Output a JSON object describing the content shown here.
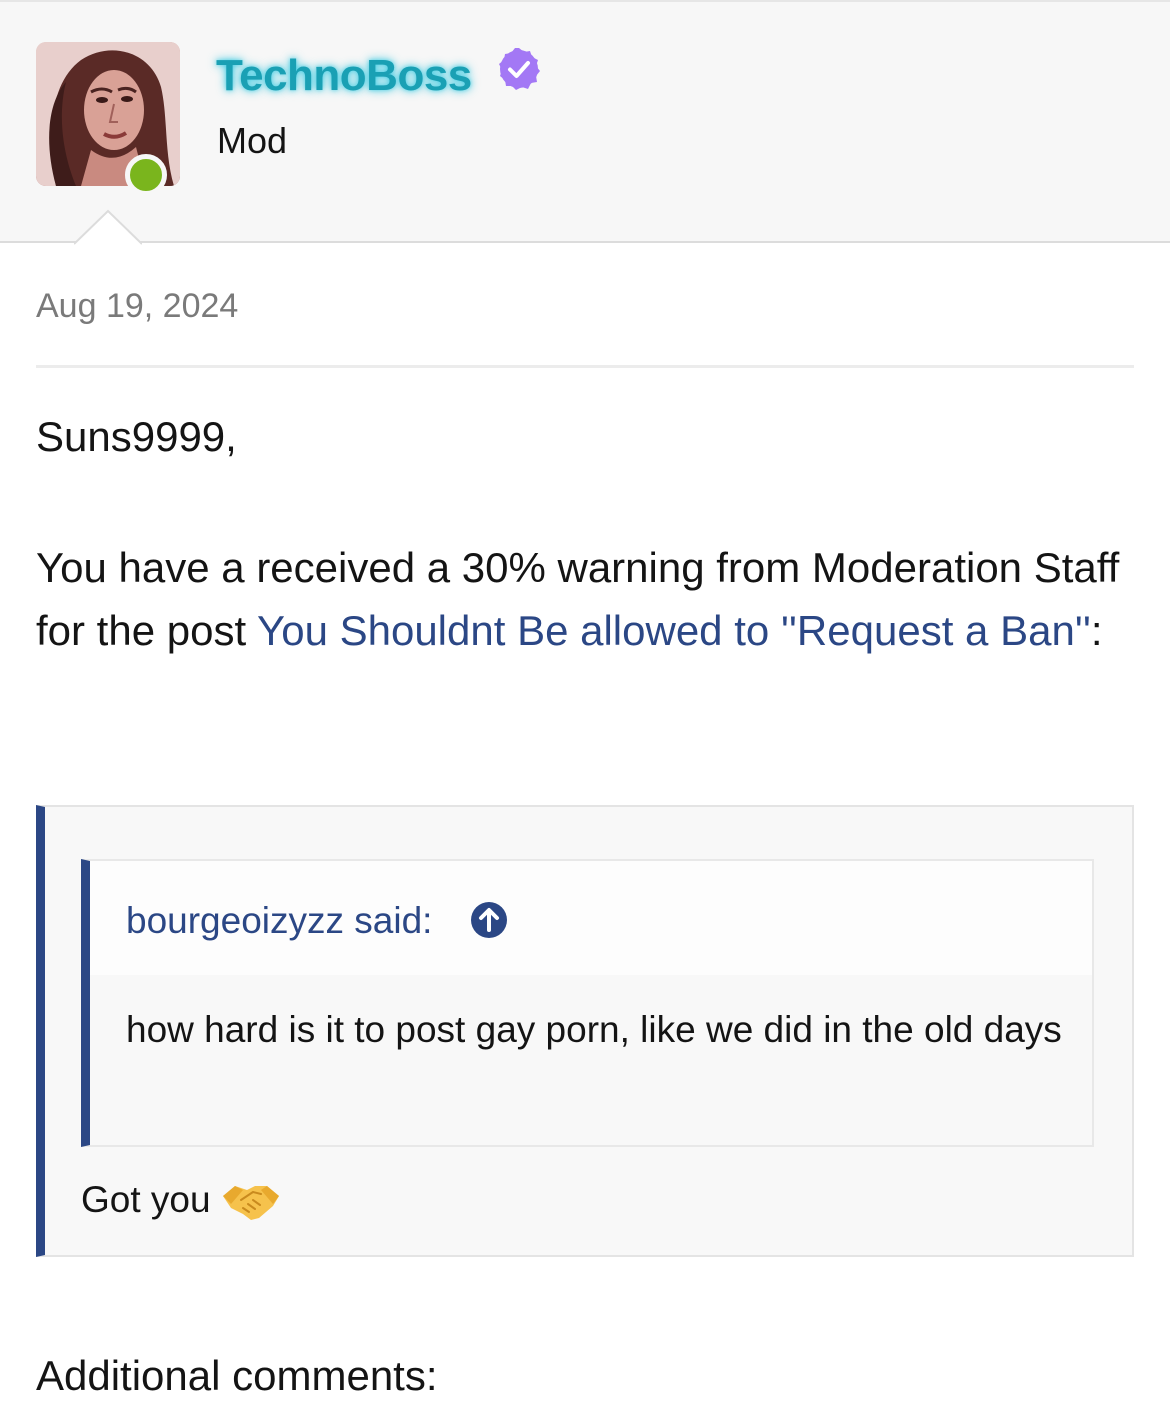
{
  "user": {
    "name": "TechnoBoss",
    "title": "Mod",
    "online": true,
    "verified": true,
    "name_color": "#1aa0b4",
    "online_color": "#7ab51d",
    "verified_color": "#a378f5"
  },
  "post": {
    "date": "Aug 19, 2024",
    "greeting": "Suns9999,",
    "message_prefix": "You have a received a 30% warning from Moderation Staff for the post ",
    "post_link": "You Shouldnt Be allowed to ''Request a Ban''",
    "message_suffix": ":",
    "link_color": "#2b4785"
  },
  "quote": {
    "author_line": "bourgeoizyzz said:",
    "text": "how hard is it to post gay porn, like we did in the old days",
    "reply": "Got you",
    "accent_color": "#2b4785"
  },
  "footer": {
    "additional_label": "Additional comments:"
  },
  "icons": {
    "verified": "verified-check-icon",
    "jump": "arrow-up-circle-icon",
    "reaction": "handshake-icon"
  }
}
